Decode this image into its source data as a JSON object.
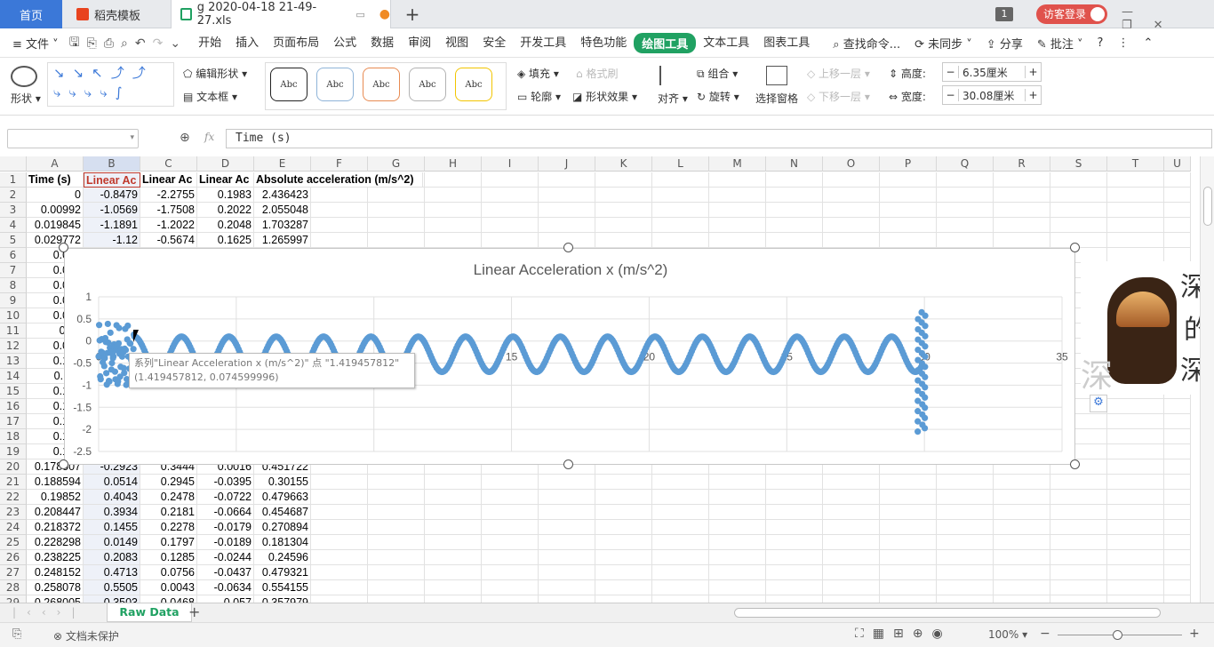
{
  "tabs": {
    "home": "首页",
    "template": "稻壳模板",
    "file": "g 2020-04-18 21-49-27.xls",
    "badge": "1",
    "login": "访客登录"
  },
  "menu": {
    "file": "文件",
    "items": [
      "开始",
      "插入",
      "页面布局",
      "公式",
      "数据",
      "审阅",
      "视图",
      "安全",
      "开发工具",
      "特色功能",
      "绘图工具",
      "文本工具",
      "图表工具"
    ],
    "active_index": 10,
    "search": "查找命令...",
    "sync": "未同步",
    "share": "分享",
    "comment": "批注"
  },
  "ribbon": {
    "shape": "形状",
    "edit_shape": "编辑形状",
    "textbox": "文本框",
    "style_sample": "Abc",
    "fill": "填充",
    "format_brush": "格式刷",
    "outline": "轮廓",
    "shape_effect": "形状效果",
    "align": "对齐",
    "group": "组合",
    "rotate": "旋转",
    "selection_pane": "选择窗格",
    "bring_forward": "上移一层",
    "send_backward": "下移一层",
    "height_label": "高度:",
    "height_value": "6.35厘米",
    "width_label": "宽度:",
    "width_value": "30.08厘米",
    "colors": {
      "accent": "#20a162",
      "chart_blue": "#5b9bd5"
    }
  },
  "formula_bar": {
    "fx": "fx",
    "value": "Time (s)"
  },
  "sheet": {
    "columns": [
      "A",
      "B",
      "C",
      "D",
      "E",
      "F",
      "G",
      "H",
      "I",
      "J",
      "K",
      "L",
      "M",
      "N",
      "O",
      "P",
      "Q",
      "R",
      "S",
      "T",
      "U"
    ],
    "headers": [
      "Time (s)",
      "Linear Ac",
      "Linear Ac",
      "Linear Ac",
      "Absolute acceleration (m/s^2)"
    ],
    "rows": [
      [
        "0",
        "-0.8479",
        "-2.2755",
        "0.1983",
        "2.436423"
      ],
      [
        "0.00992",
        "-1.0569",
        "-1.7508",
        "0.2022",
        "2.055048"
      ],
      [
        "0.019845",
        "-1.1891",
        "-1.2022",
        "0.2048",
        "1.703287"
      ],
      [
        "0.029772",
        "-1.12",
        "-0.5674",
        "0.1625",
        "1.265997"
      ],
      [
        "0.039",
        "",
        "",
        "",
        ""
      ],
      [
        "0.049",
        "",
        "",
        "",
        ""
      ],
      [
        "0.059",
        "",
        "",
        "",
        ""
      ],
      [
        "0.069",
        "",
        "",
        "",
        ""
      ],
      [
        "0.079",
        "",
        "",
        "",
        ""
      ],
      [
        "0.08",
        "",
        "",
        "",
        ""
      ],
      [
        "0.099",
        "",
        "",
        "",
        ""
      ],
      [
        "0.109",
        "",
        "",
        "",
        ""
      ],
      [
        "0.119",
        "",
        "",
        "",
        ""
      ],
      [
        "0.129",
        "",
        "",
        "",
        ""
      ],
      [
        "0.138",
        "",
        "",
        "",
        ""
      ],
      [
        "0.148",
        "",
        "",
        "",
        ""
      ],
      [
        "0.158",
        "",
        "",
        "",
        ""
      ],
      [
        "0.168",
        "",
        "",
        "",
        ""
      ],
      [
        "0.178507",
        "-0.2923",
        "0.3444",
        "0.0016",
        "0.451722"
      ],
      [
        "0.188594",
        "0.0514",
        "0.2945",
        "-0.0395",
        "0.30155"
      ],
      [
        "0.19852",
        "0.4043",
        "0.2478",
        "-0.0722",
        "0.479663"
      ],
      [
        "0.208447",
        "0.3934",
        "0.2181",
        "-0.0664",
        "0.454687"
      ],
      [
        "0.218372",
        "0.1455",
        "0.2278",
        "-0.0179",
        "0.270894"
      ],
      [
        "0.228298",
        "0.0149",
        "0.1797",
        "-0.0189",
        "0.181304"
      ],
      [
        "0.238225",
        "0.2083",
        "0.1285",
        "-0.0244",
        "0.24596"
      ],
      [
        "0.248152",
        "0.4713",
        "0.0756",
        "-0.0437",
        "0.479321"
      ],
      [
        "0.258078",
        "0.5505",
        "0.0043",
        "-0.0634",
        "0.554155"
      ],
      [
        "0.268005",
        "0.3503",
        "0.0468",
        "-0.057",
        "0.357979"
      ]
    ],
    "sheet_name": "Raw Data"
  },
  "chart_data": {
    "type": "scatter",
    "title": "Linear Acceleration x (m/s^2)",
    "xlim": [
      0,
      35
    ],
    "ylim": [
      -2.5,
      1
    ],
    "x_ticks": [
      "0",
      "5",
      "10",
      "15",
      "20",
      "25",
      "30",
      "35"
    ],
    "y_ticks": [
      "1",
      "0.5",
      "0",
      "-0.5",
      "-1",
      "-1.5",
      "-2",
      "-2.5"
    ],
    "series": [
      {
        "name": "Linear Acceleration x (m/s^2)",
        "color": "#5b9bd5"
      }
    ],
    "x_start": 0,
    "x_end": 29.9,
    "oscillation_center": -0.3,
    "oscillation_amplitude": 0.4,
    "oscillation_period": 1.72,
    "initial_burst_x_range": [
      0,
      1.3
    ],
    "end_burst_x": 29.9,
    "end_burst_y_range": [
      -2.05,
      0.65
    ]
  },
  "tooltip": {
    "line1": "系列\"Linear Acceleration x (m/s^2)\" 点 \"1.419457812\"",
    "line2": "(1.419457812, 0.074599996)"
  },
  "overlay_image": {
    "chars": [
      "深",
      "的",
      "深",
      "深"
    ]
  },
  "status": {
    "protect": "文档未保护",
    "zoom": "100%"
  }
}
